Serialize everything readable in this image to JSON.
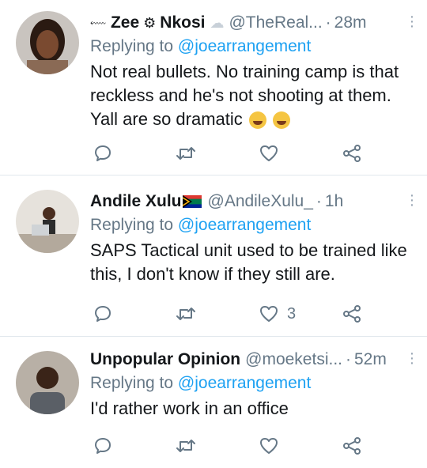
{
  "tweets": [
    {
      "name": "Zee",
      "name2": "Nkosi",
      "handle": "@TheReal...",
      "dot": "·",
      "time": "28m",
      "replying_prefix": "Replying to",
      "mention": "@joearrangement",
      "lines": [
        "Not real bullets. No training camp is that",
        "reckless and he's not shooting at them.",
        "Yall are so dramatic"
      ],
      "emoji": [
        "😂",
        "🤣"
      ],
      "like_count": ""
    },
    {
      "name": "Andile Xulu",
      "flag": "🇿🇦",
      "handle": "@AndileXulu_",
      "dot": "·",
      "time": "1h",
      "replying_prefix": "Replying to",
      "mention": "@joearrangement",
      "lines": [
        "SAPS Tactical unit used to be trained like",
        "this, I don't know if they still are."
      ],
      "like_count": "3"
    },
    {
      "name": "Unpopular Opinion",
      "handle": "@moeketsi...",
      "dot": "·",
      "time": "52m",
      "replying_prefix": "Replying to",
      "mention": "@joearrangement",
      "lines": [
        "I'd rather work in an office"
      ],
      "like_count": ""
    }
  ],
  "icons": [
    "reply-icon",
    "retweet-icon",
    "like-icon",
    "share-icon",
    "more-icon"
  ],
  "colors": {
    "mention": "#1da1f2",
    "secondary": "#657786",
    "divider": "#e1e8ed"
  }
}
